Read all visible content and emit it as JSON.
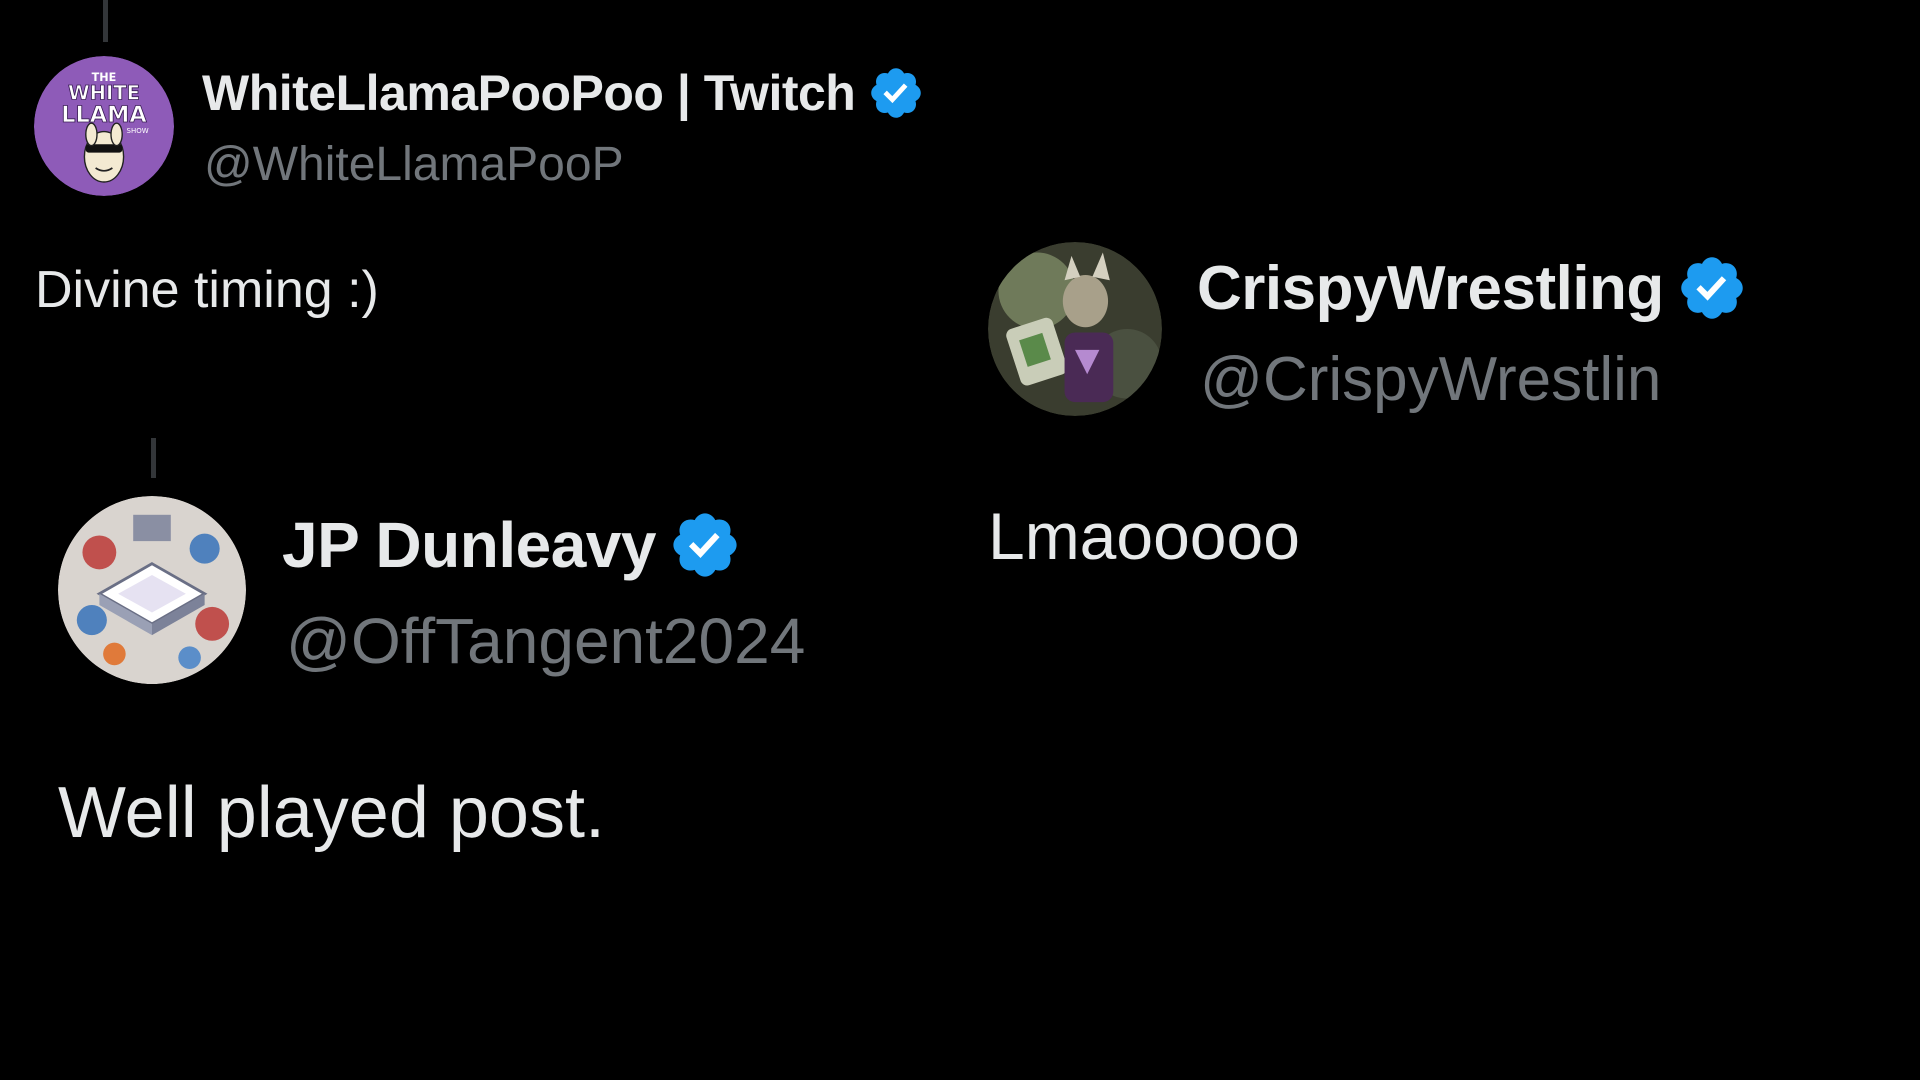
{
  "colors": {
    "background": "#000000",
    "text_primary": "#e7e9ea",
    "text_secondary": "#71767b",
    "verified_blue": "#1d9bf0"
  },
  "posts": [
    {
      "display_name": "WhiteLlamaPooPoo | Twitch",
      "handle": "@WhiteLlamaPooP",
      "text": "Divine timing :)",
      "verified": true,
      "avatar_icon": "white-llama-show-logo",
      "avatar_logo_text": "THE WHITE LLAMA SHOW"
    },
    {
      "display_name": "JP Dunleavy",
      "handle": "@OffTangent2024",
      "text": "Well played post.",
      "verified": true,
      "avatar_icon": "isometric-illustration-avatar"
    },
    {
      "display_name": "CrispyWrestling",
      "handle": "@CrispyWrestlin",
      "text": "Lmaooooo",
      "verified": true,
      "avatar_icon": "wrestler-photo-avatar"
    }
  ]
}
